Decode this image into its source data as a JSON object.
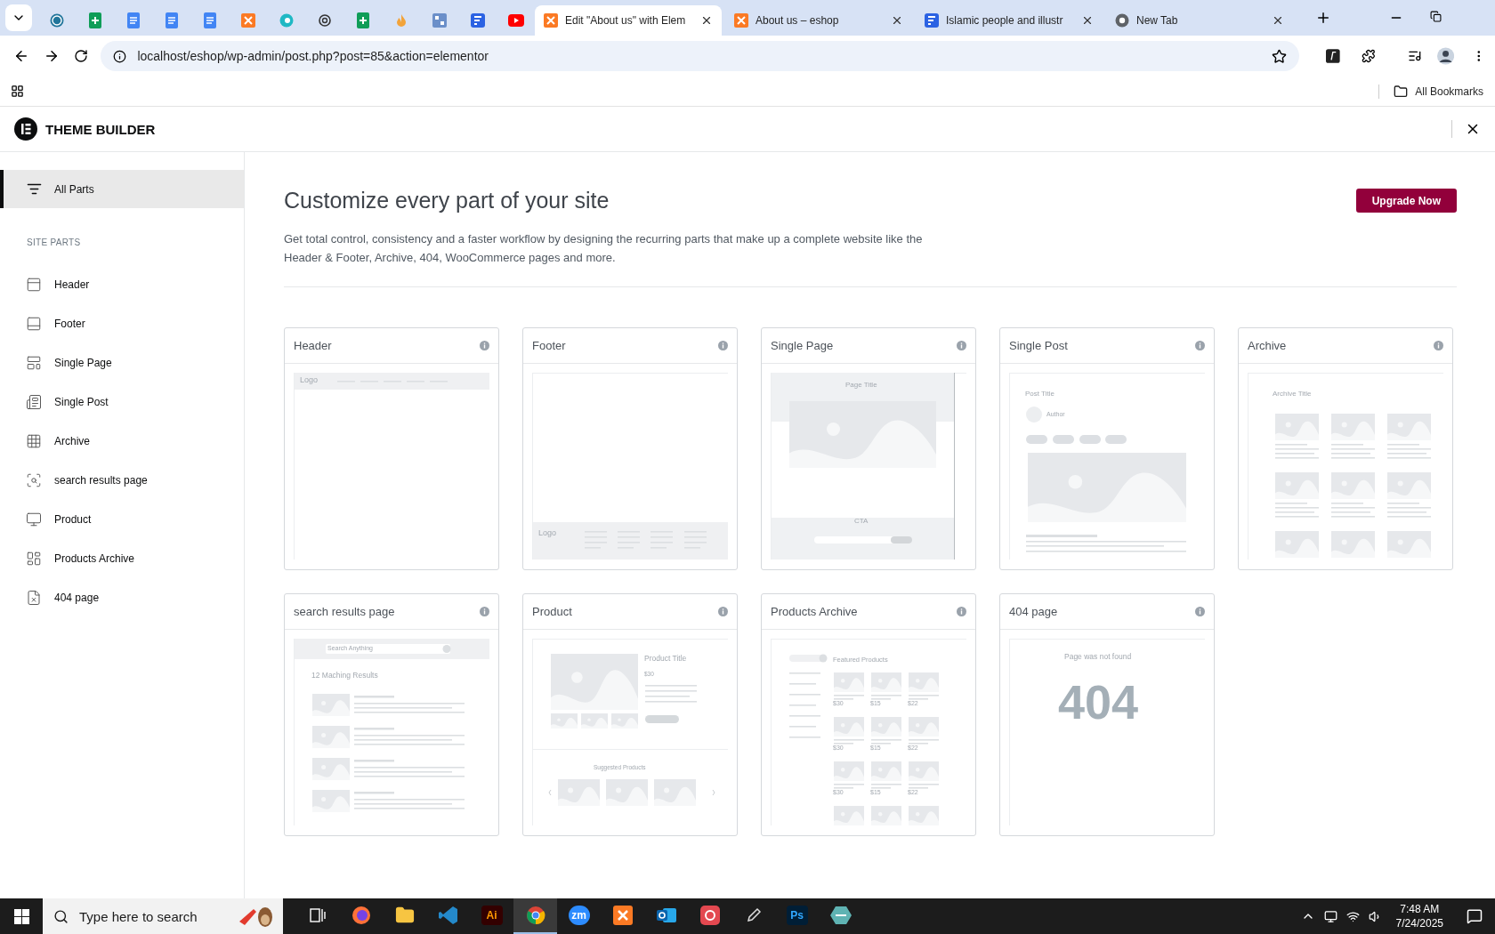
{
  "browser": {
    "tabs": [
      {
        "kind": "wordpress",
        "selected": false
      },
      {
        "kind": "sheet",
        "selected": false
      },
      {
        "kind": "doc",
        "selected": false
      },
      {
        "kind": "doc",
        "selected": false
      },
      {
        "kind": "doc",
        "selected": false
      },
      {
        "kind": "server",
        "selected": false
      },
      {
        "kind": "bird",
        "selected": false
      },
      {
        "kind": "knot",
        "selected": false
      },
      {
        "kind": "sheet",
        "selected": false
      },
      {
        "kind": "flame",
        "selected": false
      },
      {
        "kind": "grid",
        "selected": false
      },
      {
        "kind": "form",
        "selected": false
      },
      {
        "kind": "video",
        "selected": false
      },
      {
        "kind": "server",
        "title": "Edit \"About us\" with Elem",
        "selected": true
      },
      {
        "kind": "server",
        "title": "About us – eshop",
        "selected": false
      },
      {
        "kind": "form",
        "title": "Islamic people and illustr",
        "selected": false
      },
      {
        "kind": "chrome",
        "title": "New Tab",
        "selected": false
      }
    ],
    "url": "localhost/eshop/wp-admin/post.php?post=85&action=elementor",
    "bookmarks": "All Bookmarks"
  },
  "app": {
    "title": "THEME BUILDER"
  },
  "sidebar": {
    "top": [
      {
        "label": "All Parts",
        "selected": true
      }
    ],
    "section_title": "SITE PARTS",
    "parts": [
      {
        "label": "Header",
        "selected": false
      },
      {
        "label": "Footer",
        "selected": false
      },
      {
        "label": "Single Page",
        "selected": false
      },
      {
        "label": "Single Post",
        "selected": false
      },
      {
        "label": "Archive",
        "selected": false
      },
      {
        "label": "search results page",
        "selected": false
      },
      {
        "label": "Product",
        "selected": false
      },
      {
        "label": "Products Archive",
        "selected": false
      },
      {
        "label": "404 page",
        "selected": false
      }
    ]
  },
  "main": {
    "heading": "Customize every part of your site",
    "description": "Get total control, consistency and a faster workflow by designing the recurring parts that make up a complete website like the Header & Footer, Archive, 404, WooCommerce pages and more.",
    "upgrade_button": "Upgrade Now",
    "cards": [
      {
        "kind": "header",
        "title": "Header",
        "preview": {
          "logo": "Logo"
        }
      },
      {
        "kind": "footer",
        "title": "Footer",
        "preview": {
          "logo": "Logo"
        }
      },
      {
        "kind": "single-page",
        "title": "Single Page",
        "preview": {
          "title": "Page Title",
          "cta": "CTA"
        }
      },
      {
        "kind": "single-post",
        "title": "Single Post",
        "preview": {
          "title": "Post Title",
          "author": "Author"
        }
      },
      {
        "kind": "archive",
        "title": "Archive",
        "preview": {
          "title": "Archive Title"
        }
      },
      {
        "kind": "search",
        "title": "search results page",
        "preview": {
          "search_placeholder": "Search Anything",
          "results": "12 Maching Results"
        }
      },
      {
        "kind": "product",
        "title": "Product",
        "preview": {
          "title": "Product Title",
          "price": "$30",
          "suggested": "Suggested Products"
        }
      },
      {
        "kind": "products-archive",
        "title": "Products Archive",
        "preview": {
          "title": "Featured Products",
          "prices": [
            "$30",
            "$15",
            "$22",
            "$30",
            "$15",
            "$22",
            "$30",
            "$15",
            "$22"
          ]
        }
      },
      {
        "kind": "notfound",
        "title": "404 page",
        "preview": {
          "message": "Page was not found",
          "code": "404"
        }
      }
    ]
  },
  "taskbar": {
    "search_placeholder": "Type here to search",
    "apps": [
      {
        "kind": "taskview",
        "selected": false
      },
      {
        "kind": "firefox",
        "selected": false
      },
      {
        "kind": "files",
        "selected": false
      },
      {
        "kind": "vscode",
        "selected": false
      },
      {
        "kind": "illustrator",
        "label": "Ai",
        "selected": false
      },
      {
        "kind": "chrome",
        "selected": true
      },
      {
        "kind": "zoom",
        "label": "zm",
        "selected": false
      },
      {
        "kind": "server",
        "selected": false
      },
      {
        "kind": "outlook",
        "selected": false
      },
      {
        "kind": "cloud",
        "selected": false
      },
      {
        "kind": "pen",
        "selected": false
      },
      {
        "kind": "photoshop",
        "label": "Ps",
        "selected": false
      },
      {
        "kind": "gem",
        "selected": false
      }
    ],
    "time": "7:48 AM",
    "date": "7/24/2025"
  }
}
